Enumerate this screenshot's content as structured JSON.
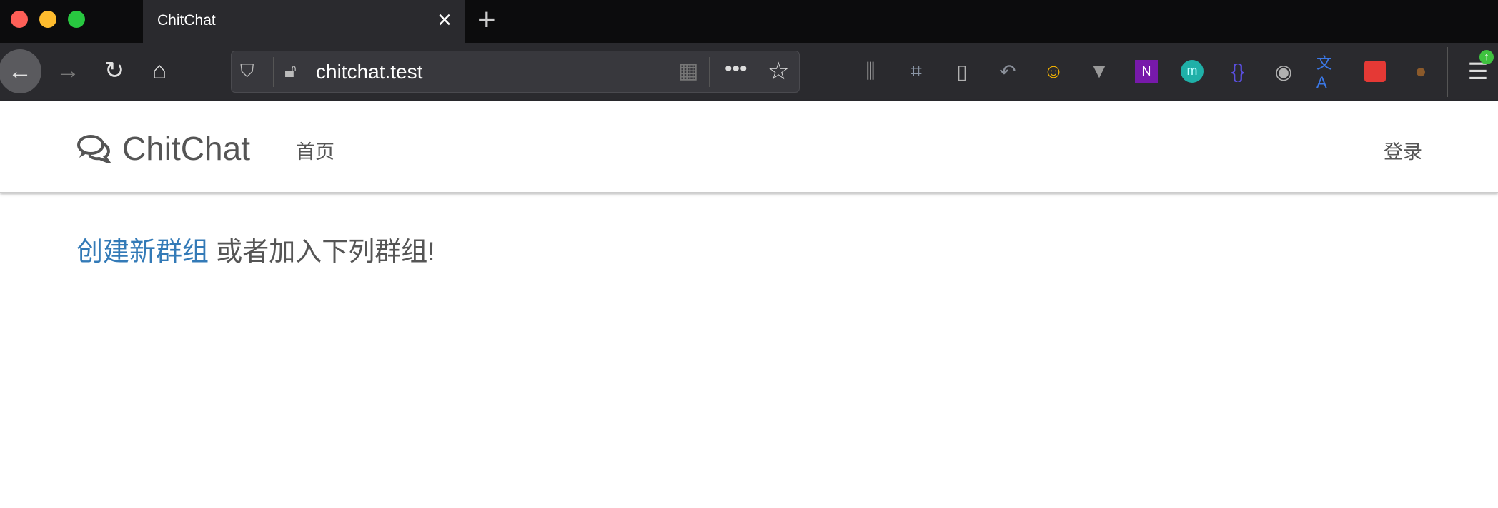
{
  "browser": {
    "tab": {
      "title": "ChitChat"
    },
    "url": "chitchat.test",
    "extensions": [
      "library-icon",
      "crop-icon",
      "reader-icon",
      "undo-icon",
      "emoji-icon",
      "vue-icon",
      "onenote-icon",
      "m-icon",
      "bracket-icon",
      "account-icon",
      "translate-icon",
      "sitemap-icon",
      "cookie-icon"
    ]
  },
  "navbar": {
    "brand": "ChitChat",
    "home": "首页",
    "login": "登录"
  },
  "content": {
    "create_link": "创建新群组",
    "rest": " 或者加入下列群组!"
  },
  "colors": {
    "link": "#337ab7",
    "text": "#555555"
  }
}
